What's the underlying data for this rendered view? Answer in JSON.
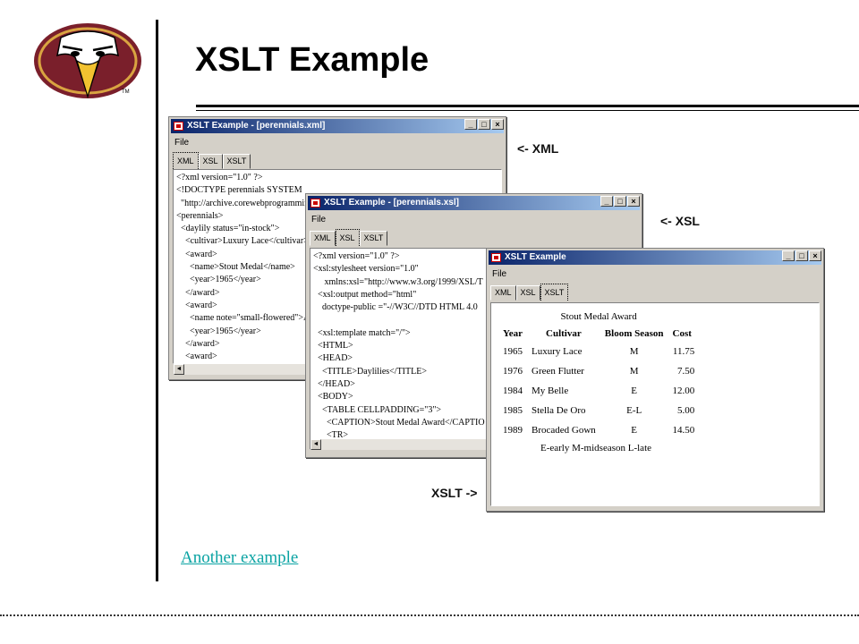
{
  "slide": {
    "title": "XSLT Example",
    "labels": {
      "xml": "<- XML",
      "xsl": "<- XSL",
      "xslt": "XSLT ->"
    },
    "link_text": "Another example"
  },
  "logo": {
    "tm": "TM",
    "colors": {
      "maroon": "#7a1f2b",
      "gold": "#d9a441"
    }
  },
  "window_xml": {
    "title": "XSLT Example - [perennials.xml]",
    "menu": [
      "File"
    ],
    "tabs": [
      "XML",
      "XSL",
      "XSLT"
    ],
    "selected_tab": "XML",
    "lines": [
      "<?xml version=\"1.0\" ?>",
      "<!DOCTYPE perennials SYSTEM",
      "  \"http://archive.corewebprogramming",
      "<perennials>",
      "  <daylily status=\"in-stock\">",
      "    <cultivar>Luxury Lace</cultivar>",
      "    <award>",
      "      <name>Stout Medal</name>",
      "      <year>1965</year>",
      "    </award>",
      "    <award>",
      "      <name note=\"small-flowered\">A",
      "      <year>1965</year>",
      "    </award>",
      "    <award>"
    ]
  },
  "window_xsl": {
    "title": "XSLT Example - [perennials.xsl]",
    "menu": [
      "File"
    ],
    "tabs": [
      "XML",
      "XSL",
      "XSLT"
    ],
    "selected_tab": "XSL",
    "lines": [
      "<?xml version=\"1.0\" ?>",
      "<xsl:stylesheet version=\"1.0\"",
      "     xmlns:xsl=\"http://www.w3.org/1999/XSL/T",
      "  <xsl:output method=\"html\"",
      "    doctype-public =\"-//W3C//DTD HTML 4.0",
      "",
      "  <xsl:template match=\"/\">",
      "  <HTML>",
      "  <HEAD>",
      "    <TITLE>Daylilies</TITLE>",
      "  </HEAD>",
      "  <BODY>",
      "    <TABLE CELLPADDING=\"3\">",
      "      <CAPTION>Stout Medal Award</CAPTIO",
      "      <TR>"
    ]
  },
  "window_xslt": {
    "title": "XSLT Example",
    "menu": [
      "File"
    ],
    "tabs": [
      "XML",
      "XSL",
      "XSLT"
    ],
    "selected_tab": "XSLT",
    "caption": "Stout Medal Award",
    "headers": [
      "Year",
      "Cultivar",
      "Bloom Season",
      "Cost"
    ],
    "rows": [
      [
        "1965",
        "Luxury Lace",
        "M",
        "11.75"
      ],
      [
        "1976",
        "Green Flutter",
        "M",
        "7.50"
      ],
      [
        "1984",
        "My Belle",
        "E",
        "12.00"
      ],
      [
        "1985",
        "Stella De Oro",
        "E-L",
        "5.00"
      ],
      [
        "1989",
        "Brocaded Gown",
        "E",
        "14.50"
      ]
    ],
    "legend": "E-early M-midseason L-late"
  },
  "window_buttons": {
    "minimize": "_",
    "maximize": "□",
    "close": "×"
  },
  "colors": {
    "titlebar_start": "#0a246a",
    "titlebar_end": "#a6caf0",
    "link": "#0aa3a3"
  }
}
